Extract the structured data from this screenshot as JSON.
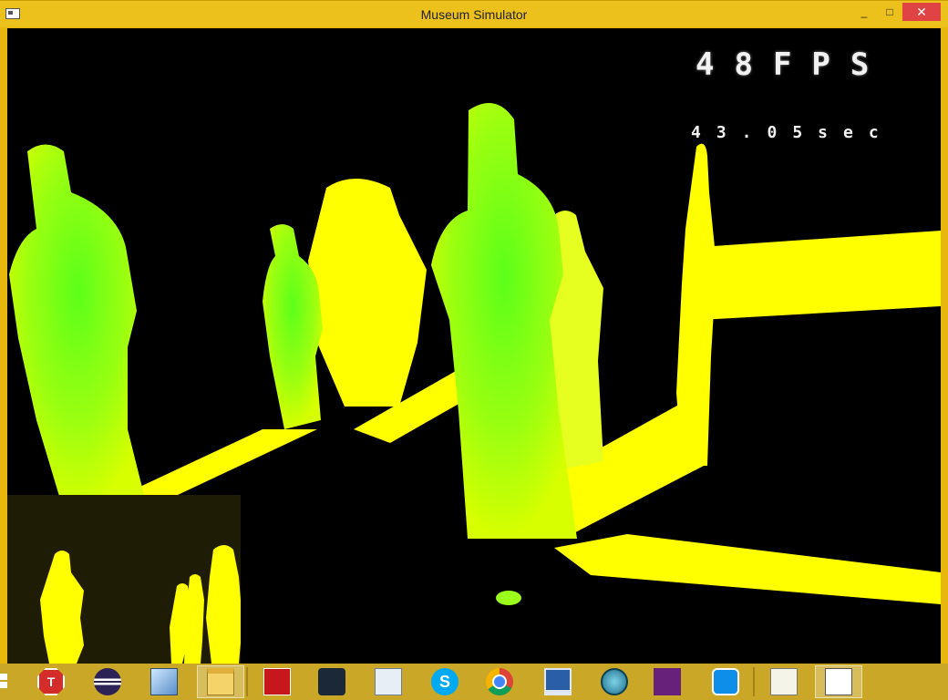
{
  "window": {
    "title": "Museum Simulator",
    "minimize": "_",
    "maximize": "□",
    "close": "✕"
  },
  "hud": {
    "fps": "48FPS",
    "timer": "43.05sec"
  },
  "colors": {
    "titlebar": "#ecc11c",
    "close": "#e04343",
    "floor": "#ffff00",
    "statue": "#9cff1a",
    "taskbar": "#caa726"
  },
  "taskbar": {
    "apps": [
      {
        "name": "t-app-icon",
        "glyph": "T"
      },
      {
        "name": "eclipse-icon",
        "glyph": ""
      },
      {
        "name": "3d-cube-icon",
        "glyph": ""
      },
      {
        "name": "file-explorer-icon",
        "glyph": ""
      },
      {
        "name": "adobe-reader-icon",
        "glyph": ""
      },
      {
        "name": "steam-icon",
        "glyph": ""
      },
      {
        "name": "performance-monitor-icon",
        "glyph": ""
      },
      {
        "name": "skype-icon",
        "glyph": "S"
      },
      {
        "name": "chrome-icon",
        "glyph": ""
      },
      {
        "name": "remote-desktop-icon",
        "glyph": ""
      },
      {
        "name": "network-tool-icon",
        "glyph": ""
      },
      {
        "name": "visual-studio-icon",
        "glyph": ""
      },
      {
        "name": "teamviewer-icon",
        "glyph": ""
      },
      {
        "name": "notepad-plus-plus-icon",
        "glyph": ""
      },
      {
        "name": "museum-simulator-taskbar-icon",
        "glyph": ""
      }
    ]
  }
}
